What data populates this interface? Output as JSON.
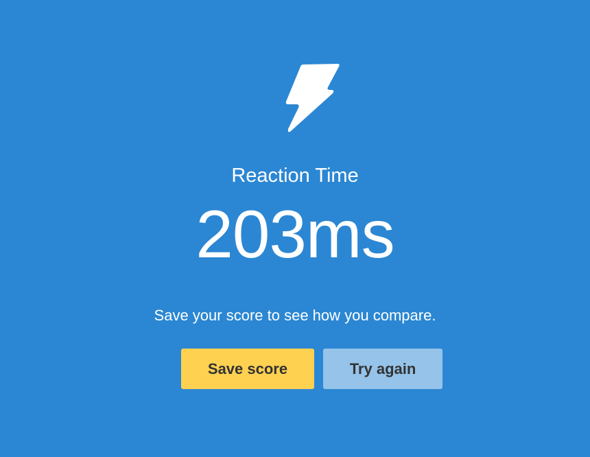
{
  "result": {
    "icon": "lightning-bolt-icon",
    "title": "Reaction Time",
    "score": "203ms",
    "subtitle": "Save your score to see how you compare.",
    "save_label": "Save score",
    "try_label": "Try again"
  },
  "colors": {
    "background": "#2b87d3",
    "text": "#ffffff",
    "save_button": "#ffd151",
    "try_button": "#95c3e9",
    "button_text": "#333333"
  }
}
